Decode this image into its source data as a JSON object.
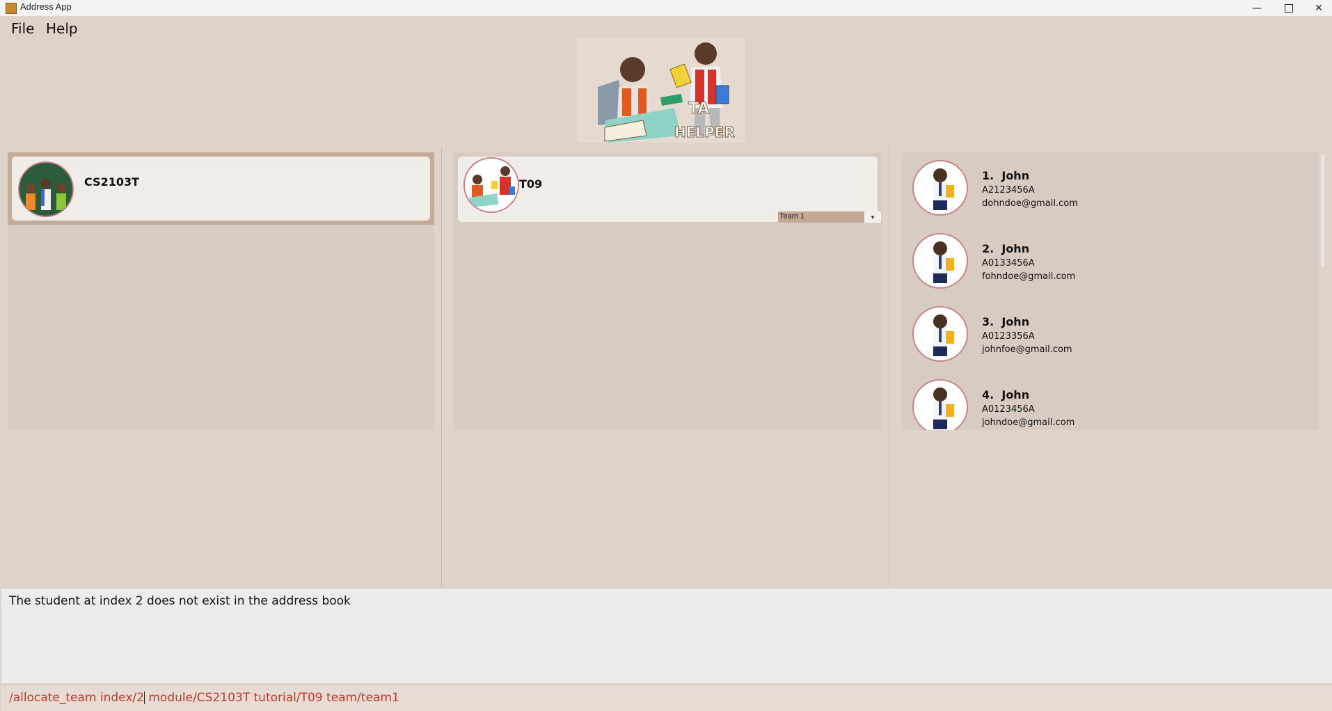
{
  "window": {
    "title": "Address App"
  },
  "menu": {
    "file": "File",
    "help": "Help"
  },
  "logo": {
    "text_line1": "TA",
    "text_line2": "HELPER"
  },
  "module": {
    "code": "CS2103T"
  },
  "tutorial": {
    "code": "T09",
    "team_selected": "Team 1"
  },
  "students": [
    {
      "index": "1.",
      "name": "John",
      "id": "A2123456A",
      "email": "dohndoe@gmail.com"
    },
    {
      "index": "2.",
      "name": "John",
      "id": "A0133456A",
      "email": "fohndoe@gmail.com"
    },
    {
      "index": "3.",
      "name": "John",
      "id": "A0123356A",
      "email": "johnfoe@gmail.com"
    },
    {
      "index": "4.",
      "name": "John",
      "id": "A0123456A",
      "email": "johndoe@gmail.com"
    }
  ],
  "result": {
    "message": "The student at index 2 does not exist in the address book"
  },
  "command": {
    "before_caret": "/allocate_team index/2",
    "after_caret": " module/CS2103T tutorial/T09 team/team1"
  },
  "colors": {
    "command_text": "#c0392b",
    "avatar_border": "#c97f86"
  }
}
